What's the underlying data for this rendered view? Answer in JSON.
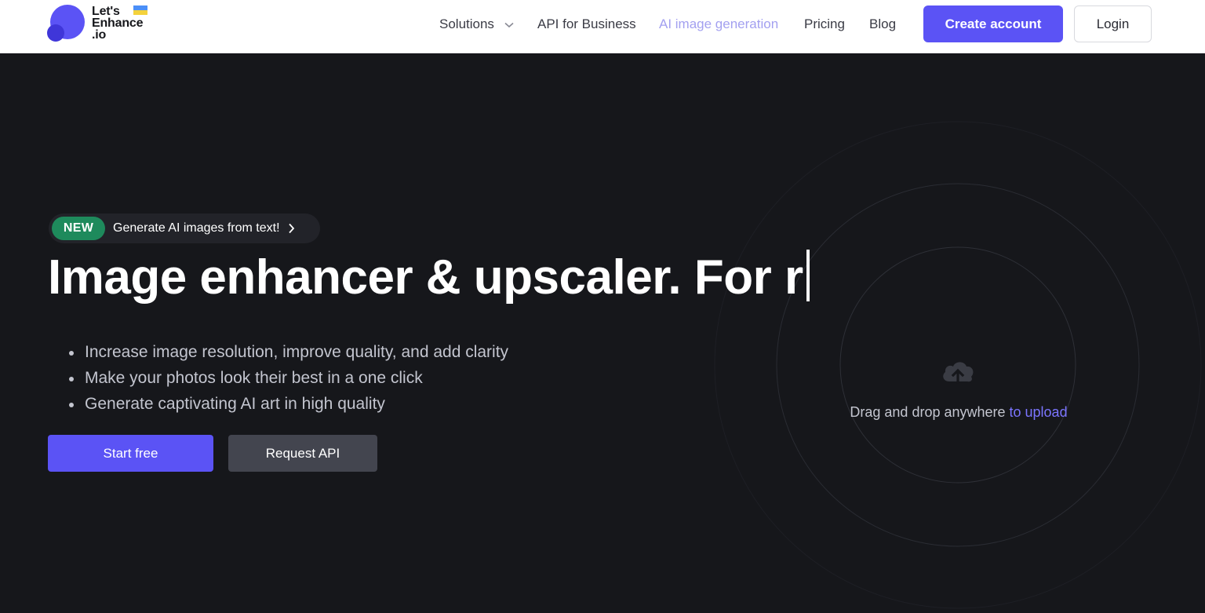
{
  "header": {
    "logo_lines": [
      "Let's",
      "Enhance",
      ".io"
    ],
    "nav": [
      {
        "label": "Solutions",
        "has_dropdown": true
      },
      {
        "label": "API for Business"
      },
      {
        "label": "AI image generation",
        "active": true
      },
      {
        "label": "Pricing"
      },
      {
        "label": "Blog"
      }
    ],
    "create_account_label": "Create account",
    "login_label": "Login"
  },
  "hero": {
    "badge": "NEW",
    "badge_text": "Generate AI images from text!",
    "headline": "Image enhancer & upscaler. For r",
    "bullets": [
      "Increase image resolution, improve quality, and add clarity",
      "Make your photos look their best in a one click",
      "Generate captivating AI art in high quality"
    ],
    "start_label": "Start free",
    "api_label": "Request API",
    "upload_text": "Drag and drop anywhere ",
    "upload_link": "to upload"
  },
  "colors": {
    "accent": "#5b53f5",
    "badge_green": "#1e8a5c",
    "background": "#16171b",
    "active_nav": "#a3a0f0",
    "link": "#7b75ff"
  },
  "icons": [
    "logo-mark",
    "ukraine-flag",
    "chevron-down-icon",
    "chevron-right-icon",
    "cloud-upload-icon"
  ]
}
